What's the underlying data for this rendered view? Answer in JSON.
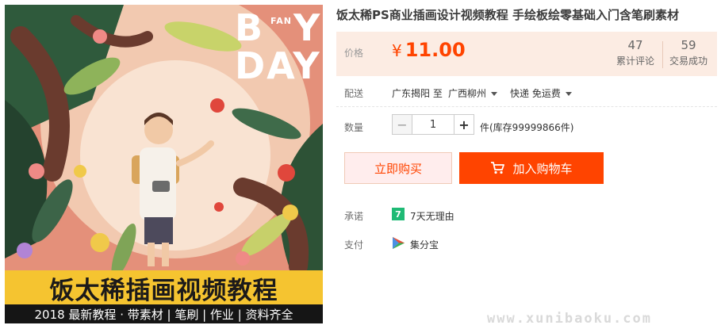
{
  "product_image": {
    "big_letter_b": "B",
    "fan_text": "FAN",
    "big_letter_y": "Y",
    "day_text": "DAY",
    "banner_title": "饭太稀插画视频教程",
    "banner_subtitle": "2018 最新教程 · 带素材 | 笔刷 | 作业 | 资料齐全"
  },
  "product": {
    "title": "饭太稀PS商业插画设计视频教程 手绘板绘零基础入门含笔刷素材"
  },
  "price": {
    "label": "价格",
    "currency": "¥",
    "amount": "11.00",
    "reviews_count": "47",
    "reviews_label": "累计评论",
    "sales_count": "59",
    "sales_label": "交易成功"
  },
  "delivery": {
    "label": "配送",
    "from": "广东揭阳 至",
    "to": "广西柳州",
    "shipping": "快递 免运费"
  },
  "quantity": {
    "label": "数量",
    "minus": "−",
    "value": "1",
    "plus": "+",
    "stock": "件(库存99999866件)"
  },
  "actions": {
    "buy_now": "立即购买",
    "add_to_cart": "加入购物车"
  },
  "promise": {
    "label": "承诺",
    "badge": "7",
    "text": "7天无理由"
  },
  "payment": {
    "label": "支付",
    "text": "集分宝"
  },
  "watermark": "www.xunibaoku.com",
  "colors": {
    "accent": "#ff4400",
    "price_bg": "#fcece3",
    "buy_bg": "#ffeded",
    "promise_green": "#1fba75"
  }
}
